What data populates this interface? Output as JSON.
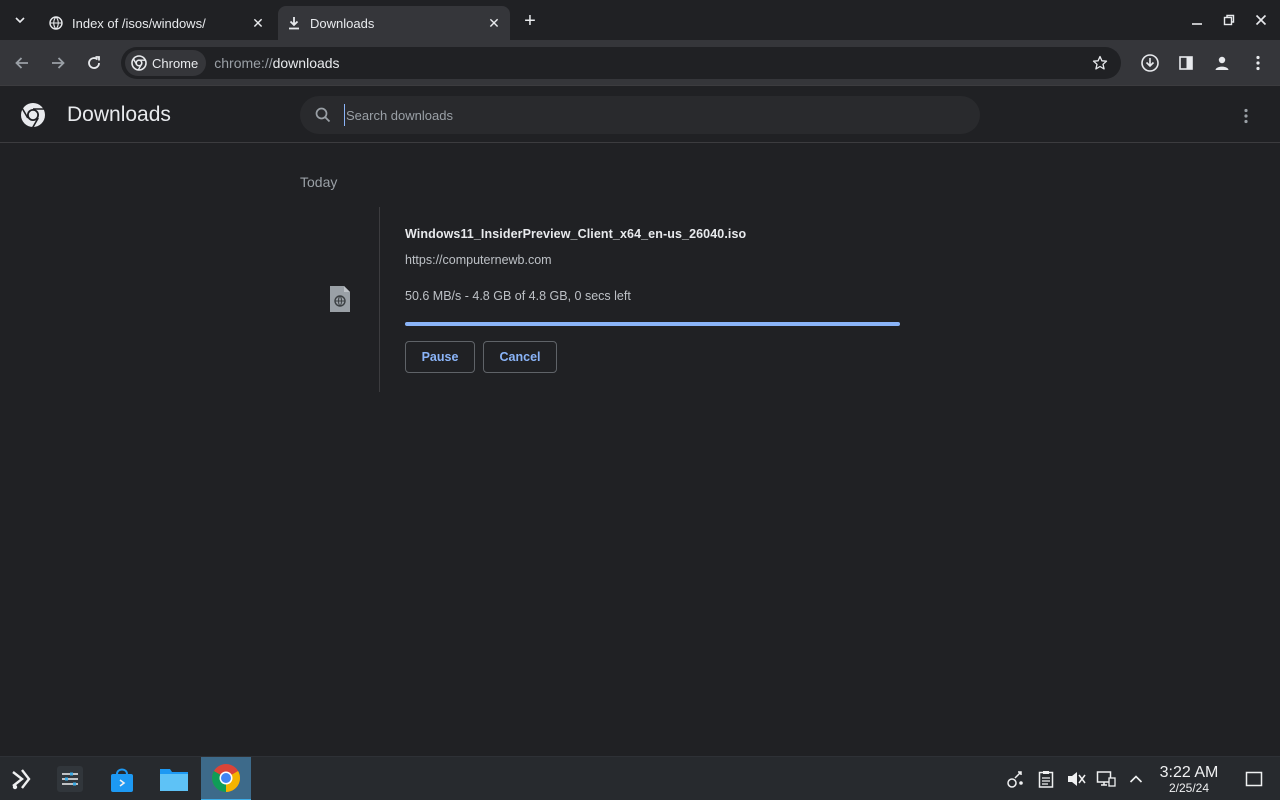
{
  "browser": {
    "tabs": [
      {
        "title": "Index of /isos/windows/",
        "active": false,
        "icon": "globe-icon"
      },
      {
        "title": "Downloads",
        "active": true,
        "icon": "download-icon"
      }
    ],
    "omnibox": {
      "chip_label": "Chrome",
      "url_scheme": "chrome://",
      "url_host": "downloads"
    }
  },
  "downloads_page": {
    "title": "Downloads",
    "search_placeholder": "Search downloads",
    "section_label": "Today",
    "items": [
      {
        "filename": "Windows11_InsiderPreview_Client_x64_en-us_26040.iso",
        "url": "https://computernewb.com",
        "status": "50.6 MB/s - 4.8 GB of 4.8 GB, 0 secs left",
        "progress_percent": 100,
        "pause_label": "Pause",
        "cancel_label": "Cancel"
      }
    ]
  },
  "taskbar": {
    "apps": [
      "application-launcher-icon",
      "system-settings-icon",
      "discover-store-icon",
      "file-manager-icon",
      "chrome-icon"
    ],
    "active_app": "chrome-icon",
    "clock": {
      "time": "3:22 AM",
      "date": "2/25/24"
    }
  },
  "colors": {
    "accent": "#8ab4f8",
    "page_bg": "#202124",
    "toolbar_bg": "#35363a",
    "taskbar_bg": "#272a2e",
    "taskbar_active": "#3daee9"
  }
}
